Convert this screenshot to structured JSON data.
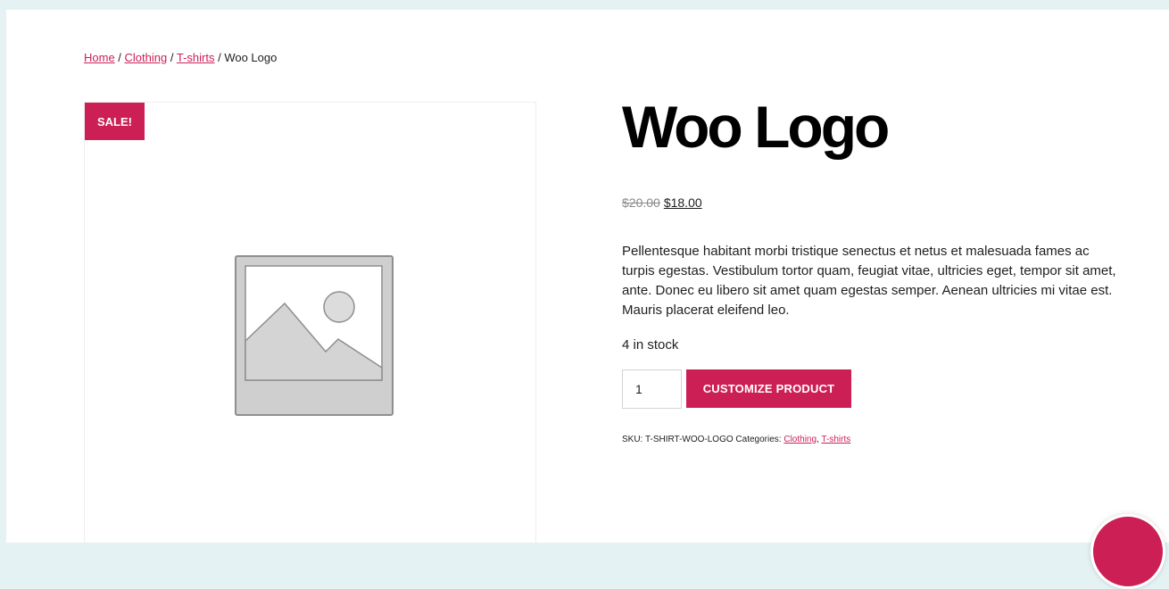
{
  "breadcrumb": {
    "home": "Home",
    "sep1": " / ",
    "clothing": "Clothing",
    "sep2": " / ",
    "tshirts": "T-shirts",
    "sep3": " / ",
    "current": "Woo Logo"
  },
  "gallery": {
    "sale_badge": "SALE!",
    "placeholder_icon": "image-placeholder-icon"
  },
  "product": {
    "title": "Woo Logo",
    "price_old": "$20.00",
    "price_new": "$18.00",
    "description": "Pellentesque habitant morbi tristique senectus et netus et malesuada fames ac turpis egestas. Vestibulum tortor quam, feugiat vitae, ultricies eget, tempor sit amet, ante. Donec eu libero sit amet quam egestas semper. Aenean ultricies mi vitae est. Mauris placerat eleifend leo.",
    "stock": "4 in stock",
    "quantity": "1",
    "add_button_label": "CUSTOMIZE PRODUCT"
  },
  "meta": {
    "sku_label": "SKU: ",
    "sku_value": "T-SHIRT-WOO-LOGO",
    "categories_label": " Categories: ",
    "category_1": "Clothing",
    "category_sep": ", ",
    "category_2": "T-shirts"
  },
  "colors": {
    "accent": "#cc1f56",
    "background": "#e4f2f4",
    "page": "#ffffff"
  }
}
